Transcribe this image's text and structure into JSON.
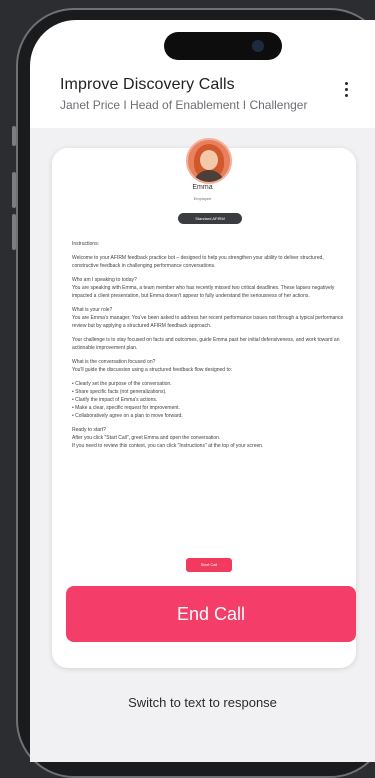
{
  "header": {
    "title": "Improve Discovery Calls",
    "subtitle": "Janet Price  I  Head of Enablement  I  Challenger"
  },
  "persona": {
    "name": "Emma",
    "role": "Employee",
    "badge": "Standard AFIRM"
  },
  "instructions": {
    "p1": "Instructions:",
    "p2": "Welcome to your AFIRM feedback practice bot – designed to help you strengthen your ability to deliver structured, constructive feedback in challenging performance conversations.",
    "p3_title": "Who am I speaking to today?",
    "p3": "You are speaking with Emma, a team member who has recently missed two critical deadlines. These lapses negatively impacted a client presentation, but Emma doesn't appear to fully understand the seriousness of her actions.",
    "p4_title": "What is your role?",
    "p4": "You are Emma's manager. You've been asked to address her recent performance issues not through a typical performance review but by applying a structured AFIRM feedback approach.",
    "p5": "Your challenge is to stay focused on facts and outcomes, guide Emma past her initial defensiveness, and work toward an actionable improvement plan.",
    "p6_title": "What is the conversation focused on?",
    "p6": "You'll guide the discussion using a structured feedback flow designed to:",
    "bullets": [
      "Clearly set the purpose of the conversation.",
      "Share specific facts (not generalizations).",
      "Clarify the impact of Emma's actions.",
      "Make a clear, specific request for improvement.",
      "Collaboratively agree on a plan to move forward."
    ],
    "p7_title": "Ready to start?",
    "p7a": "After you click \"Start Call\", greet Emma and open the conversation.",
    "p7b": "If you need to review this context, you can click \"Instructions\" at the top of your screen."
  },
  "buttons": {
    "start": "Start Call",
    "end": "End Call",
    "switch": "Switch to text to response"
  },
  "icons": {
    "menu": "kebab-menu-icon",
    "camera": "camera-icon"
  },
  "colors": {
    "accent": "#f43d68",
    "badge": "#3b3c40"
  }
}
